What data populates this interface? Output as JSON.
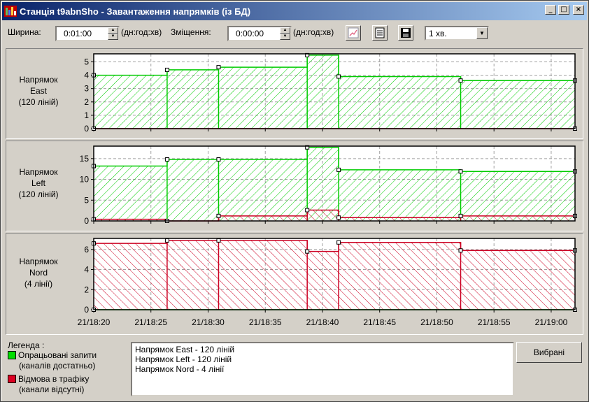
{
  "window": {
    "title": "Станція t9abnSho - Завантаження напрямків (із БД)",
    "minimize_label": "_",
    "maximize_label": "□",
    "close_label": "×"
  },
  "toolbar": {
    "width_label": "Ширина:",
    "width_value": "0:01:00",
    "width_units": "(дн:год:хв)",
    "offset_label": "Зміщення:",
    "offset_value": "0:00:00",
    "offset_units": "(дн:год:хв)",
    "interval_value": "1 хв."
  },
  "colors": {
    "ok": "#00cc00",
    "refusal": "#cc0022"
  },
  "chart_data": [
    {
      "type": "area",
      "label": [
        "Напрямок",
        "East",
        "(120 ліній)"
      ],
      "ylim": [
        0,
        5.6
      ],
      "yticks": [
        0,
        1,
        2,
        3,
        4,
        5
      ],
      "x": [
        "21/18:20",
        "21/18:25",
        "21/18:30",
        "21/18:35",
        "21/18:40",
        "21/18:45",
        "21/18:50",
        "21/18:55",
        "21/19:00"
      ],
      "series": [
        {
          "role": "ok",
          "points": [
            [
              "18:20:00",
              4.0
            ],
            [
              "18:26:25",
              4.0
            ],
            [
              "18:26:25",
              4.4
            ],
            [
              "18:30:55",
              4.4
            ],
            [
              "18:30:55",
              4.6
            ],
            [
              "18:38:40",
              4.6
            ],
            [
              "18:38:40",
              5.5
            ],
            [
              "18:41:25",
              5.5
            ],
            [
              "18:41:25",
              3.9
            ],
            [
              "18:52:05",
              3.9
            ],
            [
              "18:52:05",
              3.6
            ],
            [
              "19:02:05",
              3.6
            ]
          ]
        },
        {
          "role": "refusal",
          "points": [
            [
              "18:20:00",
              0
            ],
            [
              "19:02:05",
              0
            ]
          ]
        }
      ]
    },
    {
      "type": "area",
      "label": [
        "Напрямок",
        "Left",
        "(120 ліній)"
      ],
      "ylim": [
        0,
        18
      ],
      "yticks": [
        0,
        5,
        10,
        15
      ],
      "x": [
        "21/18:20",
        "21/18:25",
        "21/18:30",
        "21/18:35",
        "21/18:40",
        "21/18:45",
        "21/18:50",
        "21/18:55",
        "21/19:00"
      ],
      "series": [
        {
          "role": "ok",
          "points": [
            [
              "18:20:00",
              13.2
            ],
            [
              "18:26:25",
              13.2
            ],
            [
              "18:26:25",
              14.8
            ],
            [
              "18:30:55",
              14.8
            ],
            [
              "18:30:55",
              14.8
            ],
            [
              "18:38:40",
              14.8
            ],
            [
              "18:38:40",
              17.7
            ],
            [
              "18:41:25",
              17.7
            ],
            [
              "18:41:25",
              12.3
            ],
            [
              "18:52:05",
              12.3
            ],
            [
              "18:52:05",
              11.9
            ],
            [
              "19:02:05",
              11.9
            ]
          ]
        },
        {
          "role": "refusal",
          "points": [
            [
              "18:20:00",
              0.4
            ],
            [
              "18:26:25",
              0.4
            ],
            [
              "18:26:25",
              0
            ],
            [
              "18:30:55",
              0
            ],
            [
              "18:30:55",
              1.2
            ],
            [
              "18:38:40",
              1.2
            ],
            [
              "18:38:40",
              2.6
            ],
            [
              "18:41:25",
              2.6
            ],
            [
              "18:41:25",
              0.8
            ],
            [
              "18:52:05",
              0.8
            ],
            [
              "18:52:05",
              1.2
            ],
            [
              "19:02:05",
              1.2
            ]
          ]
        }
      ]
    },
    {
      "type": "area",
      "label": [
        "Напрямок",
        "Nord",
        "(4 лінії)"
      ],
      "ylim": [
        0,
        7.1
      ],
      "yticks": [
        0,
        2,
        4,
        6
      ],
      "x": [
        "21/18:20",
        "21/18:25",
        "21/18:30",
        "21/18:35",
        "21/18:40",
        "21/18:45",
        "21/18:50",
        "21/18:55",
        "21/19:00"
      ],
      "series": [
        {
          "role": "ok",
          "points": [
            [
              "18:20:00",
              0
            ],
            [
              "19:02:05",
              0
            ]
          ]
        },
        {
          "role": "refusal",
          "points": [
            [
              "18:20:00",
              6.6
            ],
            [
              "18:26:25",
              6.6
            ],
            [
              "18:26:25",
              6.9
            ],
            [
              "18:30:55",
              6.9
            ],
            [
              "18:30:55",
              6.9
            ],
            [
              "18:38:40",
              6.9
            ],
            [
              "18:38:40",
              5.8
            ],
            [
              "18:41:25",
              5.8
            ],
            [
              "18:41:25",
              6.7
            ],
            [
              "18:52:05",
              6.7
            ],
            [
              "18:52:05",
              5.9
            ],
            [
              "19:02:05",
              5.9
            ]
          ]
        }
      ]
    }
  ],
  "legend": {
    "title": "Легенда :",
    "ok_line1": "Опрацьовані запити",
    "ok_line2": "(каналів достатньо)",
    "refusal_line1": "Відмова в трафіку",
    "refusal_line2": "(канали відсутні)"
  },
  "directions_list": [
    "Напрямок East - 120 ліній",
    "Напрямок Left - 120 ліній",
    "Напрямок Nord - 4 лінії"
  ],
  "selected_button": "Вибрані"
}
